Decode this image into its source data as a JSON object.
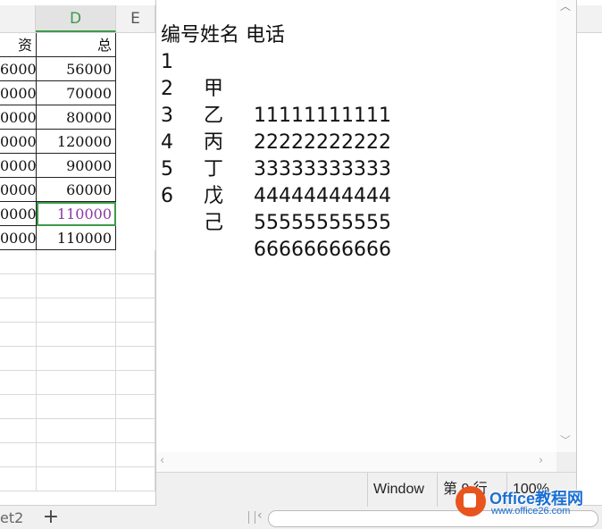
{
  "spreadsheet": {
    "columns": {
      "d": "D",
      "e": "E"
    },
    "header_row": {
      "col_c": "资",
      "col_d": "总"
    },
    "rows": [
      {
        "c": "6000",
        "d": "56000"
      },
      {
        "c": "0000",
        "d": "70000"
      },
      {
        "c": "0000",
        "d": "80000"
      },
      {
        "c": "0000",
        "d": "120000"
      },
      {
        "c": "0000",
        "d": "90000"
      },
      {
        "c": "0000",
        "d": "60000"
      },
      {
        "c": "0000",
        "d": "110000"
      },
      {
        "c": "0000",
        "d": "110000"
      }
    ],
    "sheet_tab": "et2",
    "add_sheet": "+"
  },
  "notepad": {
    "lines": [
      {
        "c1": "编号姓名 电话",
        "c2": "",
        "c3": ""
      },
      {
        "c1": "1",
        "c2": "甲",
        "c3": "11111111111"
      },
      {
        "c1": "2",
        "c2": "乙",
        "c3": "22222222222"
      },
      {
        "c1": "3",
        "c2": "丙",
        "c3": "33333333333"
      },
      {
        "c1": "4",
        "c2": "丁",
        "c3": "44444444444"
      },
      {
        "c1": "5",
        "c2": "戊",
        "c3": "55555555555"
      },
      {
        "c1": "6",
        "c2": "己",
        "c3": "66666666666"
      }
    ],
    "status": {
      "encoding": "Window",
      "position": "第 9 行",
      "zoom": "100%"
    }
  },
  "watermark": {
    "title": "Office教程网",
    "url": "www.office26.com"
  },
  "colors": {
    "accent_green": "#3d9a4a",
    "selected_text": "#8b3aa6",
    "watermark_blue": "#1b6fd1",
    "watermark_orange": "#e8541e"
  }
}
